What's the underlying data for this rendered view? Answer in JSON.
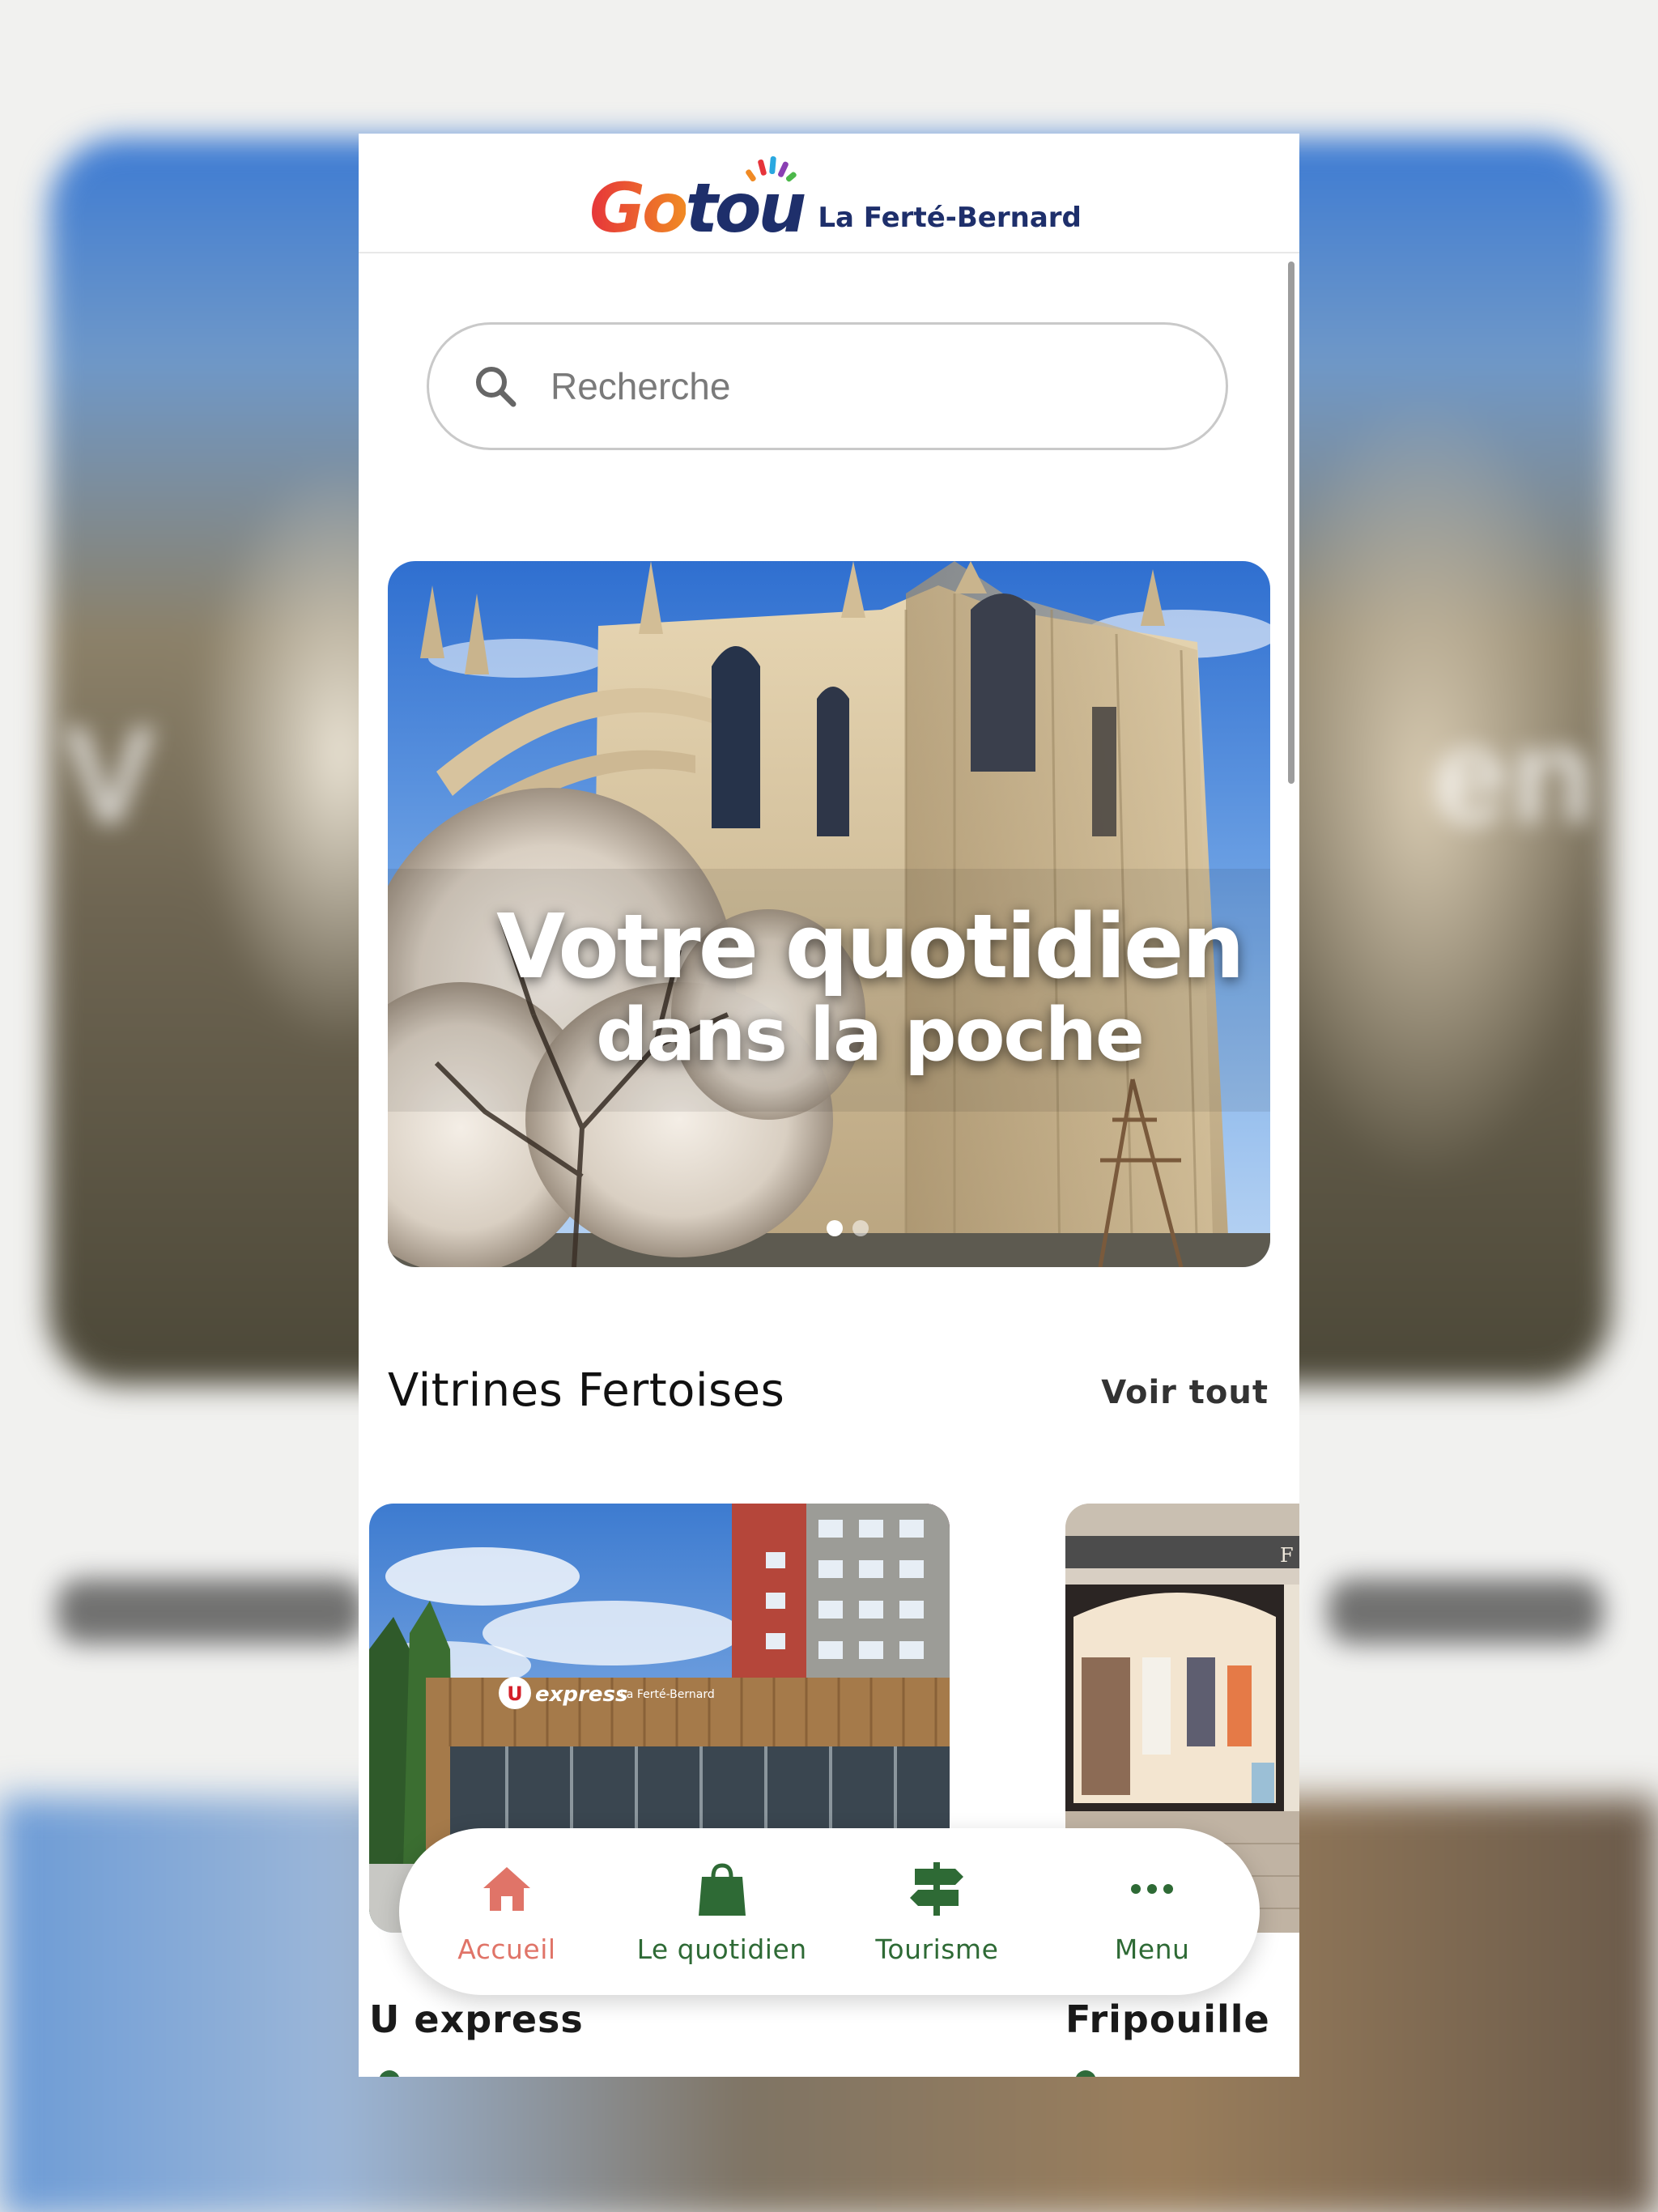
{
  "app": {
    "brand_part1": "Go",
    "brand_part2": "tou",
    "city": "La Ferté-Bernard"
  },
  "search": {
    "placeholder": "Recherche",
    "value": ""
  },
  "hero": {
    "line1": "Votre quotidien",
    "line2": "dans la poche",
    "slide_count": 2,
    "active_slide": 1
  },
  "section": {
    "title": "Vitrines Fertoises",
    "see_all": "Voir tout"
  },
  "cards": [
    {
      "name": "U express",
      "sign": "express",
      "sign_city": "La Ferté-Bernard"
    },
    {
      "name": "Fripouille"
    }
  ],
  "nav": {
    "items": [
      {
        "label": "Accueil",
        "icon": "home-icon",
        "active": true
      },
      {
        "label": "Le quotidien",
        "icon": "shopping-bag-icon",
        "active": false
      },
      {
        "label": "Tourisme",
        "icon": "signpost-icon",
        "active": false
      },
      {
        "label": "Menu",
        "icon": "more-dots-icon",
        "active": false
      }
    ]
  },
  "colors": {
    "accent_green": "#2e6a35",
    "active_coral": "#e07468",
    "brand_navy": "#1e2f6b",
    "brand_orange": "#f08a24"
  }
}
